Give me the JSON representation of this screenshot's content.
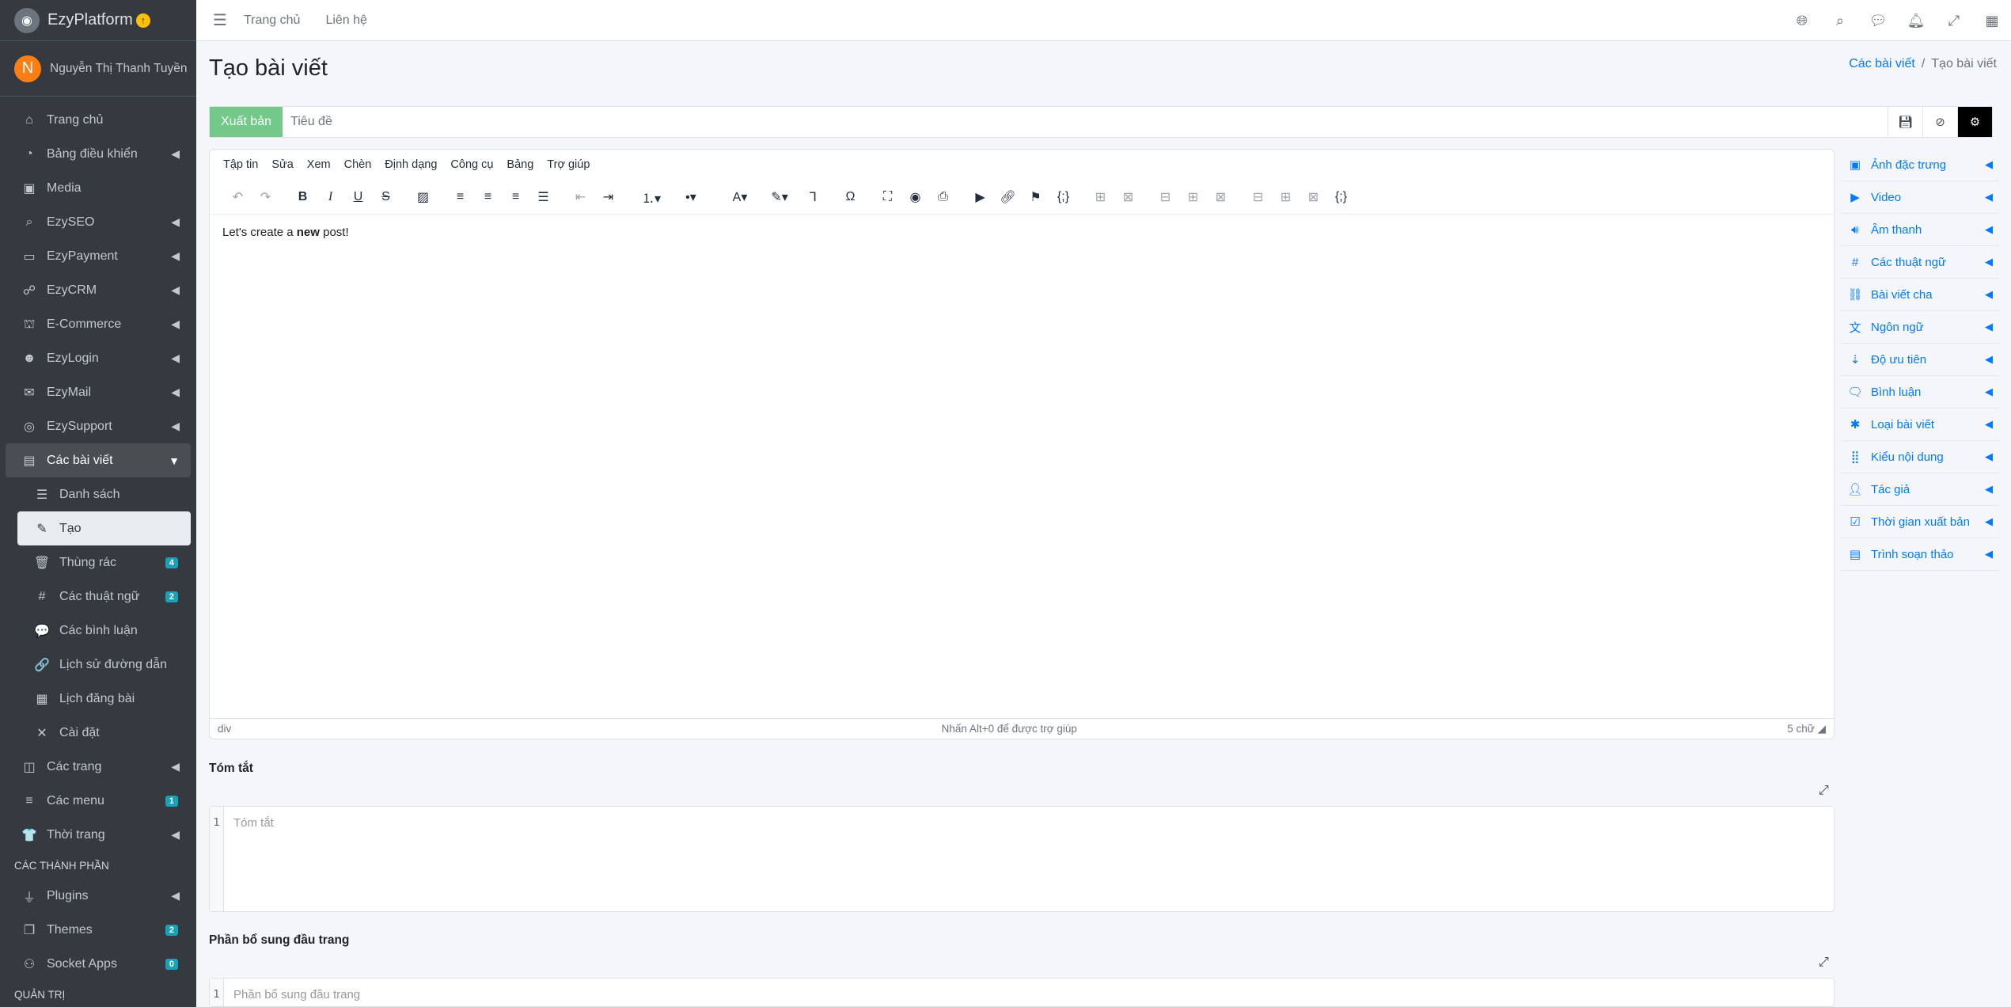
{
  "brand": {
    "name": "EzyPlatform"
  },
  "user": {
    "initial": "N",
    "name": "Nguyễn Thị Thanh Tuyền"
  },
  "sidebar": {
    "items": [
      {
        "label": "Trang chủ",
        "icon": "home-icon"
      },
      {
        "label": "Bảng điều khiển",
        "icon": "dashboard-icon"
      },
      {
        "label": "Media",
        "icon": "image-icon"
      },
      {
        "label": "EzySEO",
        "icon": "search-plus-icon"
      },
      {
        "label": "EzyPayment",
        "icon": "credit-card-icon"
      },
      {
        "label": "EzyCRM",
        "icon": "handshake-icon"
      },
      {
        "label": "E-Commerce",
        "icon": "basket-icon"
      },
      {
        "label": "EzyLogin",
        "icon": "user-lock-icon"
      },
      {
        "label": "EzyMail",
        "icon": "envelope-icon"
      },
      {
        "label": "EzySupport",
        "icon": "life-ring-icon"
      },
      {
        "label": "Các bài viết",
        "icon": "newspaper-icon"
      }
    ],
    "subitems": [
      {
        "label": "Danh sách",
        "icon": "list-icon"
      },
      {
        "label": "Tạo",
        "icon": "edit-icon"
      },
      {
        "label": "Thùng rác",
        "icon": "trash-icon",
        "badge": "4"
      },
      {
        "label": "Các thuật ngữ",
        "icon": "hashtag-icon",
        "badge": "2"
      },
      {
        "label": "Các bình luận",
        "icon": "comments-icon"
      },
      {
        "label": "Lịch sử đường dẫn",
        "icon": "link-icon"
      },
      {
        "label": "Lịch đăng bài",
        "icon": "calendar-icon"
      },
      {
        "label": "Cài đặt",
        "icon": "tools-icon"
      }
    ],
    "more": [
      {
        "label": "Các trang",
        "icon": "columns-icon"
      },
      {
        "label": "Các menu",
        "icon": "bars-icon",
        "badge": "1"
      },
      {
        "label": "Thời trang",
        "icon": "shirt-icon"
      }
    ],
    "header_components": "CÁC THÀNH PHẦN",
    "components": [
      {
        "label": "Plugins",
        "icon": "plug-icon"
      },
      {
        "label": "Themes",
        "icon": "clone-icon",
        "badge": "2"
      },
      {
        "label": "Socket Apps",
        "icon": "network-icon",
        "badge": "0"
      }
    ],
    "header_admin": "QUẢN TRỊ"
  },
  "topbar": {
    "links": [
      "Trang chủ",
      "Liên hệ"
    ]
  },
  "page": {
    "title": "Tạo bài viết",
    "breadcrumb": {
      "parent": "Các bài viết",
      "current": "Tạo bài viết"
    }
  },
  "form": {
    "publish_label": "Xuất bản",
    "title_placeholder": "Tiêu đề"
  },
  "editor": {
    "menus": [
      "Tập tin",
      "Sửa",
      "Xem",
      "Chèn",
      "Định dạng",
      "Công cụ",
      "Bảng",
      "Trợ giúp"
    ],
    "content_prefix": "Let's create a ",
    "content_bold": "new",
    "content_suffix": " post!",
    "status_path": "div",
    "status_help": "Nhấn Alt+0 để được trợ giúp",
    "status_words": "5 chữ"
  },
  "summary": {
    "label": "Tóm tắt",
    "line": "1",
    "placeholder": "Tóm tắt"
  },
  "header_extra": {
    "label": "Phần bổ sung đầu trang",
    "line": "1",
    "placeholder": "Phần bổ sung đầu trang"
  },
  "right_panel": {
    "items": [
      {
        "label": "Ảnh đặc trưng",
        "icon": "image-icon"
      },
      {
        "label": "Video",
        "icon": "youtube-icon"
      },
      {
        "label": "Âm thanh",
        "icon": "volume-icon"
      },
      {
        "label": "Các thuật ngữ",
        "icon": "hashtag-icon"
      },
      {
        "label": "Bài viết cha",
        "icon": "project-diagram-icon"
      },
      {
        "label": "Ngôn ngữ",
        "icon": "language-icon"
      },
      {
        "label": "Độ ưu tiên",
        "icon": "sort-numeric-icon"
      },
      {
        "label": "Bình luận",
        "icon": "comment-icon"
      },
      {
        "label": "Loại bài viết",
        "icon": "asterisk-icon"
      },
      {
        "label": "Kiểu nội dung",
        "icon": "grid-icon"
      },
      {
        "label": "Tác giả",
        "icon": "user-icon"
      },
      {
        "label": "Thời gian xuất bản",
        "icon": "calendar-check-icon"
      },
      {
        "label": "Trình soạn thảo",
        "icon": "editor-icon"
      }
    ]
  },
  "colors": {
    "sidebar_bg": "#343a40",
    "accent": "#007bff",
    "publish": "#72c98a",
    "badge": "#17a2b8"
  }
}
